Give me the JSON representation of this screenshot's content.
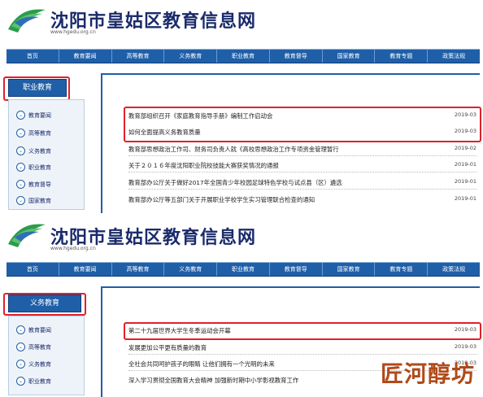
{
  "site": {
    "title": "沈阳市皇姑区教育信息网",
    "url": "www.hgedu.org.cn"
  },
  "nav": [
    "首页",
    "教育要闻",
    "高等教育",
    "义务教育",
    "职业教育",
    "教育督导",
    "国家教育",
    "教育专题",
    "政策法规"
  ],
  "panel1": {
    "sidebar_title": "职业教育",
    "sidebar_items": [
      "教育要闻",
      "高等教育",
      "义务教育",
      "职业教育",
      "教育督导",
      "国家教育"
    ],
    "rows": [
      {
        "title": "教育部组织召开《家庭教育指导手册》编制工作启动会",
        "date": "2019-03"
      },
      {
        "title": "如何全面提高义务教育质量",
        "date": "2019-03"
      },
      {
        "title": "教育部思想政治工作司、财务司负责人就《高校思想政治工作专项资金管理暂行",
        "date": "2019-02"
      },
      {
        "title": "关于２０１６年度沈阳职业院校技能大赛获奖情况的通报",
        "date": "2019-01"
      },
      {
        "title": "教育部办公厅关于做好2017年全国青少年校园足球特色学校与试点县（区）遴选",
        "date": "2019-01"
      },
      {
        "title": "教育部办公厅等五部门关于开展职业学校学生实习管理联合检查的通知",
        "date": "2019-01"
      }
    ]
  },
  "panel2": {
    "sidebar_title": "义务教育",
    "sidebar_items": [
      "教育要闻",
      "高等教育",
      "义务教育",
      "职业教育"
    ],
    "rows": [
      {
        "title": "第二十九届世界大学生冬季运动会开幕",
        "date": "2019-03"
      },
      {
        "title": "发展更加公平更有质量的教育",
        "date": "2019-03"
      },
      {
        "title": "全社会共同呵护孩子的眼睛 让他们拥有一个光明的未来",
        "date": "2019-03"
      },
      {
        "title": "深入学习贯彻全国教育大会精神 加强新时期中小学影视教育工作",
        "date": ""
      }
    ]
  },
  "watermark": "匠河醇坊",
  "colors": {
    "nav_blue": "#1f5fa8",
    "highlight_red": "#e0212b",
    "title_navy": "#1a2b6b"
  }
}
